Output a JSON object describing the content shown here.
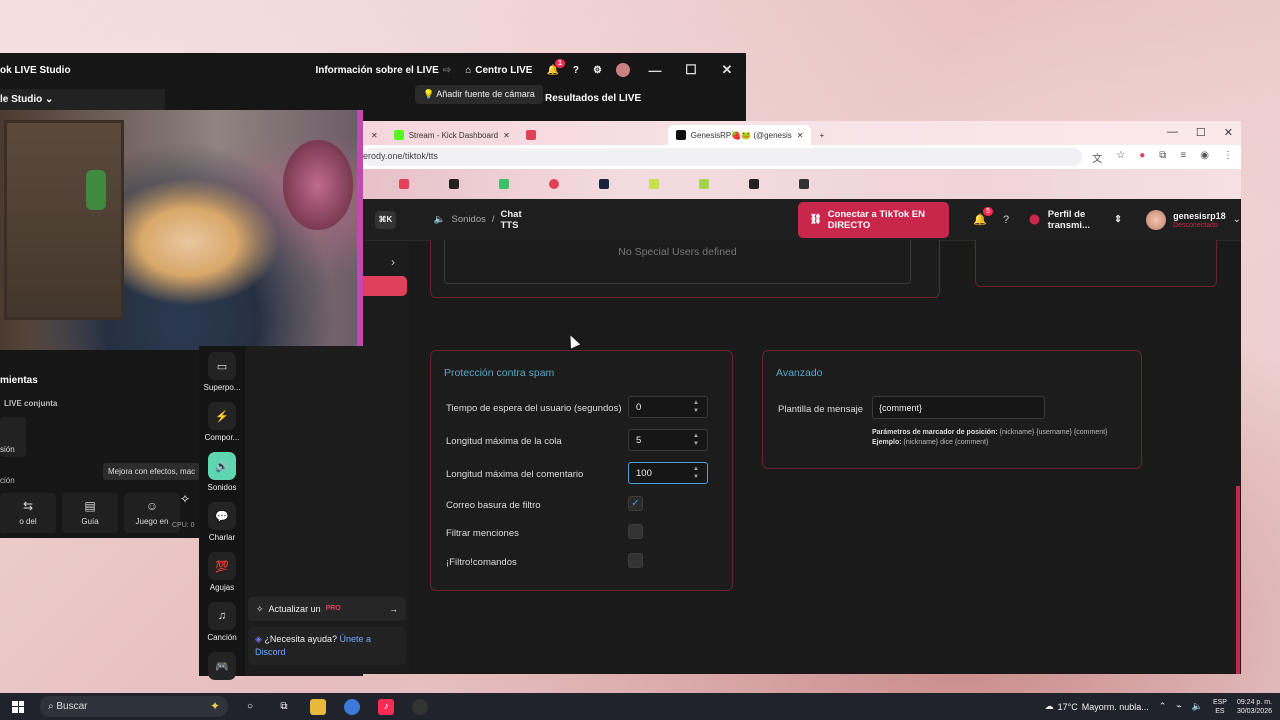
{
  "tiktok_studio": {
    "title": "ok LIVE Studio",
    "live_info": "Información sobre el LIVE",
    "live_center": "Centro LIVE",
    "notif_count": "1",
    "studio_menu": "le Studio",
    "add_camera": "Añadir fuente de cámara",
    "live_results": "Resultados del LIVE",
    "tools_title": "mientas",
    "live_joint": "LIVE conjunta",
    "sion": "sión",
    "cion": "ción",
    "tooltip": "Mejora con efectos, mac",
    "bottom_tools": [
      {
        "label": "o del",
        "icon": "⇆"
      },
      {
        "label": "Guía",
        "icon": "▤"
      },
      {
        "label": "Juego en",
        "icon": "☺"
      }
    ],
    "cpu": "CPU: 0"
  },
  "chrome": {
    "tabs": [
      {
        "label": "",
        "color": "#f5a9b8"
      },
      {
        "label": "Stream - Kick Dashboard",
        "color": "#53fc18"
      },
      {
        "label": "",
        "color": "#e0405a"
      },
      {
        "label": "GenesisRP🍓🐸 (@genesis",
        "color": "#111111"
      }
    ],
    "url": "erody.one/tiktok/tts"
  },
  "app": {
    "shortcut": "⌘K",
    "breadcrumb_parent": "Sonidos",
    "breadcrumb_sep": "/",
    "breadcrumb_current": "Chat TTS",
    "connect_button": "Conectar a TikTok EN DIRECTO",
    "notif_count": "5",
    "profile_select": "Perfil de transmi...",
    "username": "genesisrp18",
    "user_status": "Desconectado",
    "nav": [
      {
        "label": "Superpo...",
        "icon": "▭",
        "selected": false
      },
      {
        "label": "Compor...",
        "icon": "⚡",
        "selected": false
      },
      {
        "label": "Sonidos",
        "icon": "🔊",
        "selected": true
      },
      {
        "label": "Charlar",
        "icon": "💬",
        "selected": false
      },
      {
        "label": "Agujas",
        "icon": "💯",
        "selected": false
      },
      {
        "label": "Canción",
        "icon": "♫",
        "selected": false
      },
      {
        "label": "",
        "icon": "🎮",
        "selected": false
      }
    ],
    "upgrade_label": "Actualizar un",
    "upgrade_pro": "PRO",
    "help_text": "¿Necesita ayuda?",
    "help_link": "Únete a",
    "help_link2": "Discord"
  },
  "special_users": {
    "empty_text": "No Special Users defined"
  },
  "spam": {
    "title": "Protección contra spam",
    "user_cooldown_label": "Tiempo de espera del usuario (segundos)",
    "user_cooldown_value": "0",
    "queue_label": "Longitud máxima de la cola",
    "queue_value": "5",
    "comment_label": "Longitud máxima del comentario",
    "comment_value": "100",
    "filter_spam_label": "Correo basura de filtro",
    "filter_spam_checked": true,
    "filter_mentions_label": "Filtrar menciones",
    "filter_mentions_checked": false,
    "filter_commands_label": "¡Filtro!comandos",
    "filter_commands_checked": false
  },
  "advanced": {
    "title": "Avanzado",
    "template_label": "Plantilla de mensaje",
    "template_value": "{comment}",
    "params_title": "Parámetros de marcador de posición:",
    "params_value": "{nickname} {username} {comment}",
    "example_title": "Ejemplo:",
    "example_value": "{nickname} dice {comment}"
  },
  "taskbar": {
    "search": "Buscar",
    "temperature": "17°C",
    "weather": "Mayorm. nubla...",
    "lang_top": "ESP",
    "lang_bottom": "ES",
    "time": "09:24 p. m.",
    "date": "30/03/2026"
  },
  "colors": {
    "accent": "#c8264a",
    "panel_border": "#6a2430",
    "panel_title": "#5aa6c8",
    "nav_selected": "#5ed6b0"
  }
}
